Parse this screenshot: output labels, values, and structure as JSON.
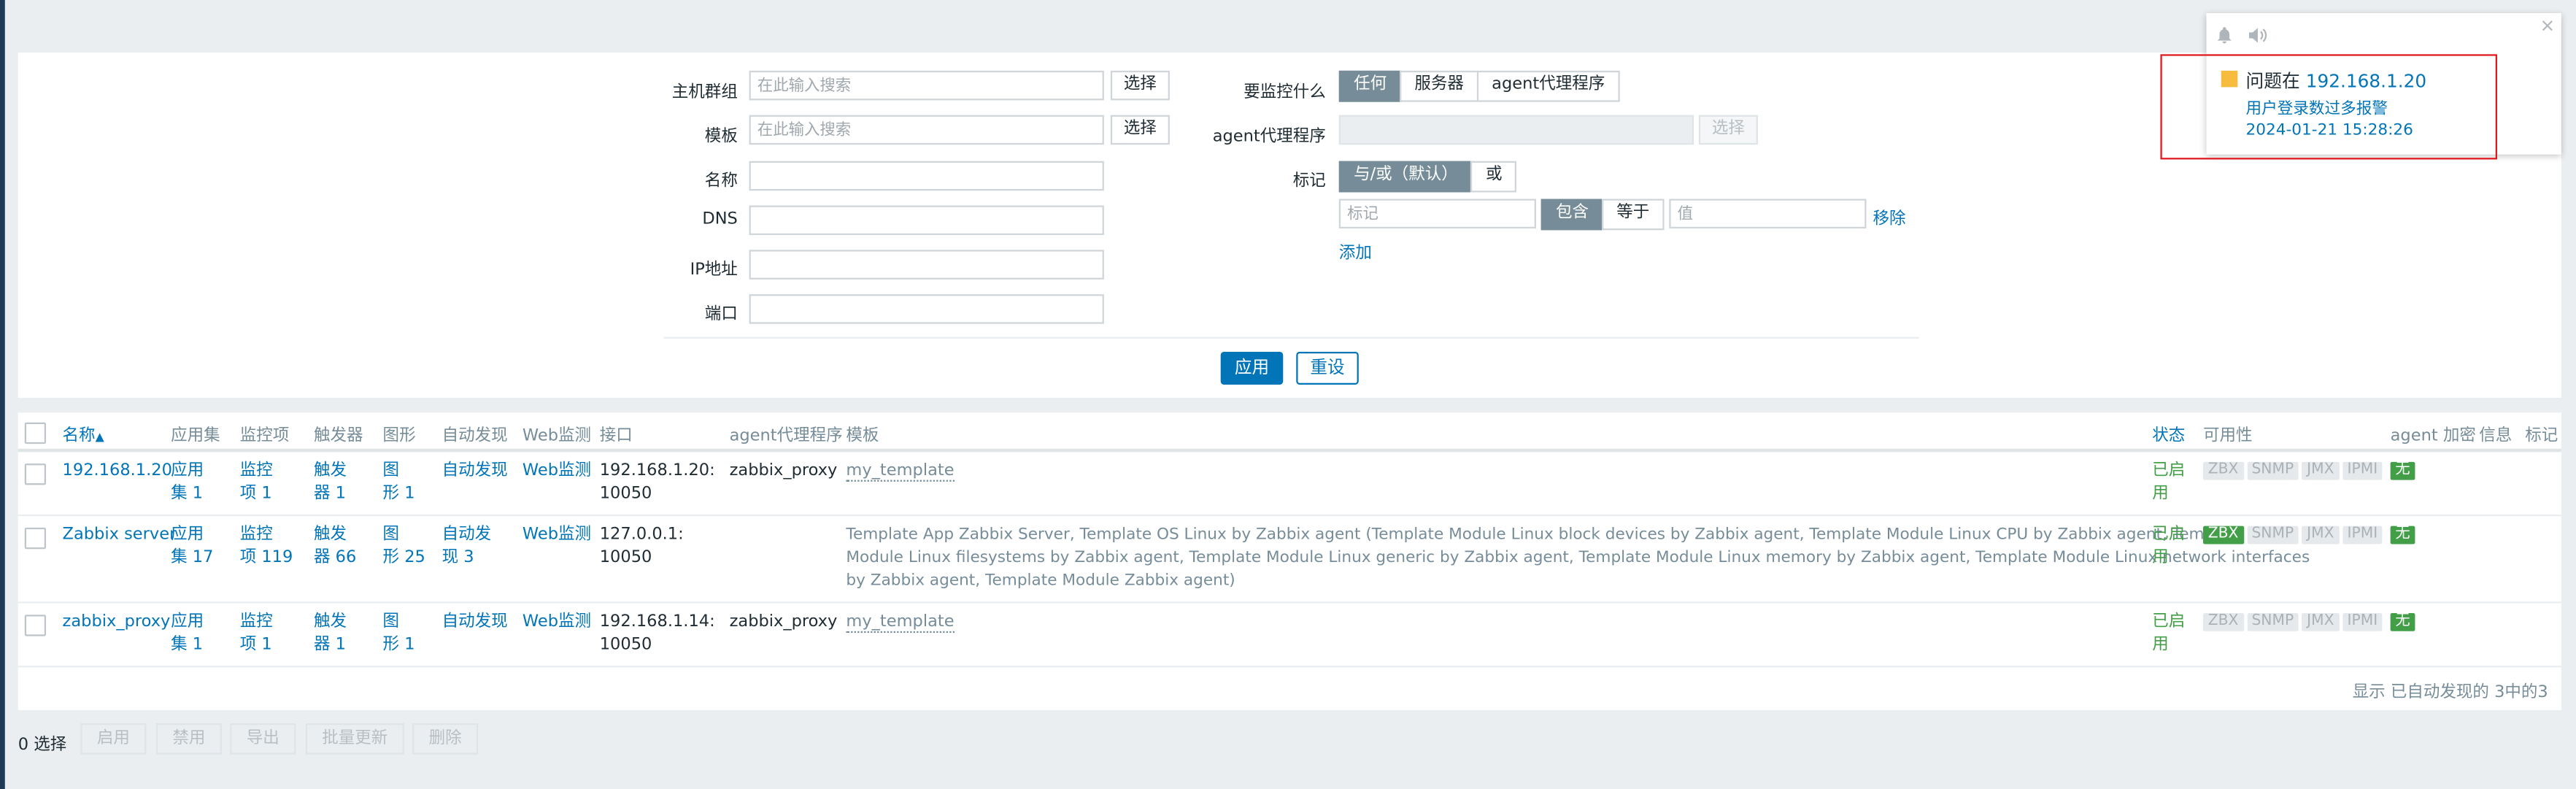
{
  "filter": {
    "host_group": {
      "label": "主机群组",
      "placeholder": "在此输入搜索",
      "select": "选择"
    },
    "template": {
      "label": "模板",
      "placeholder": "在此输入搜索",
      "select": "选择"
    },
    "name": {
      "label": "名称",
      "value": ""
    },
    "dns": {
      "label": "DNS",
      "value": ""
    },
    "ip": {
      "label": "IP地址",
      "value": ""
    },
    "port": {
      "label": "端口",
      "value": ""
    },
    "monitored_by": {
      "label": "要监控什么",
      "options": [
        "任何",
        "服务器",
        "agent代理程序"
      ],
      "selected": "任何"
    },
    "proxy": {
      "label": "agent代理程序",
      "select": "选择"
    },
    "tags": {
      "label": "标记",
      "operator_options": [
        "与/或（默认）",
        "或"
      ],
      "tag_placeholder": "标记",
      "match_options": [
        "包含",
        "等于"
      ],
      "value_placeholder": "值",
      "remove": "移除",
      "add": "添加"
    },
    "apply": "应用",
    "reset": "重设"
  },
  "table": {
    "headers": [
      "名称",
      "应用集",
      "监控项",
      "触发器",
      "图形",
      "自动发现",
      "Web监测",
      "接口",
      "agent代理程序",
      "模板",
      "状态",
      "可用性",
      "agent 加密",
      "信息",
      "标记"
    ],
    "sort_indicator": "▲",
    "rows": [
      {
        "name": "192.168.1.20",
        "apps": [
          "应用",
          "集 1"
        ],
        "items": [
          "监控",
          "项 1"
        ],
        "triggers": [
          "触发",
          "器 1"
        ],
        "graphs": [
          "图",
          "形 1"
        ],
        "discovery": [
          "自动发现",
          ""
        ],
        "web": "Web监测",
        "interface": [
          "192.168.1.20:",
          "10050"
        ],
        "proxy": "zabbix_proxy",
        "templates": "my_template",
        "status": [
          "已启",
          "用"
        ],
        "availability": [
          "ZBX",
          "SNMP",
          "JMX",
          "IPMI"
        ],
        "zbx_on": false,
        "encryption": "无"
      },
      {
        "name": "Zabbix server",
        "apps": [
          "应用",
          "集 17"
        ],
        "items": [
          "监控",
          "项 119"
        ],
        "triggers": [
          "触发",
          "器 66"
        ],
        "graphs": [
          "图",
          "形 25"
        ],
        "discovery": [
          "自动发",
          "现 3"
        ],
        "web": "Web监测",
        "interface": [
          "127.0.0.1:",
          "10050"
        ],
        "proxy": "",
        "templates_lines": [
          "Template App Zabbix Server, Template OS Linux by Zabbix agent (Template Module Linux block devices by Zabbix agent, Template Module Linux CPU by Zabbix agent, Template",
          "Module Linux filesystems by Zabbix agent, Template Module Linux generic by Zabbix agent, Template Module Linux memory by Zabbix agent, Template Module Linux network interfaces",
          "by Zabbix agent, Template Module Zabbix agent)"
        ],
        "status": [
          "已启",
          "用"
        ],
        "availability": [
          "ZBX",
          "SNMP",
          "JMX",
          "IPMI"
        ],
        "zbx_on": true,
        "encryption": "无"
      },
      {
        "name": "zabbix_proxy",
        "apps": [
          "应用",
          "集 1"
        ],
        "items": [
          "监控",
          "项 1"
        ],
        "triggers": [
          "触发",
          "器 1"
        ],
        "graphs": [
          "图",
          "形 1"
        ],
        "discovery": [
          "自动发现",
          ""
        ],
        "web": "Web监测",
        "interface": [
          "192.168.1.14:",
          "10050"
        ],
        "proxy": "zabbix_proxy",
        "templates": "my_template",
        "status": [
          "已启",
          "用"
        ],
        "availability": [
          "ZBX",
          "SNMP",
          "JMX",
          "IPMI"
        ],
        "zbx_on": false,
        "encryption": "无"
      }
    ],
    "footer": "显示 已自动发现的 3中的3"
  },
  "bottom": {
    "selected_count": "0 选择",
    "actions": [
      "启用",
      "禁用",
      "导出",
      "批量更新",
      "删除"
    ]
  },
  "notification": {
    "prefix": "问题在",
    "host": "192.168.1.20",
    "problem": "用户登录数过多报警",
    "time": "2024-01-21 15:28:26",
    "close": "×",
    "severity_color": "#f7bb3d"
  }
}
